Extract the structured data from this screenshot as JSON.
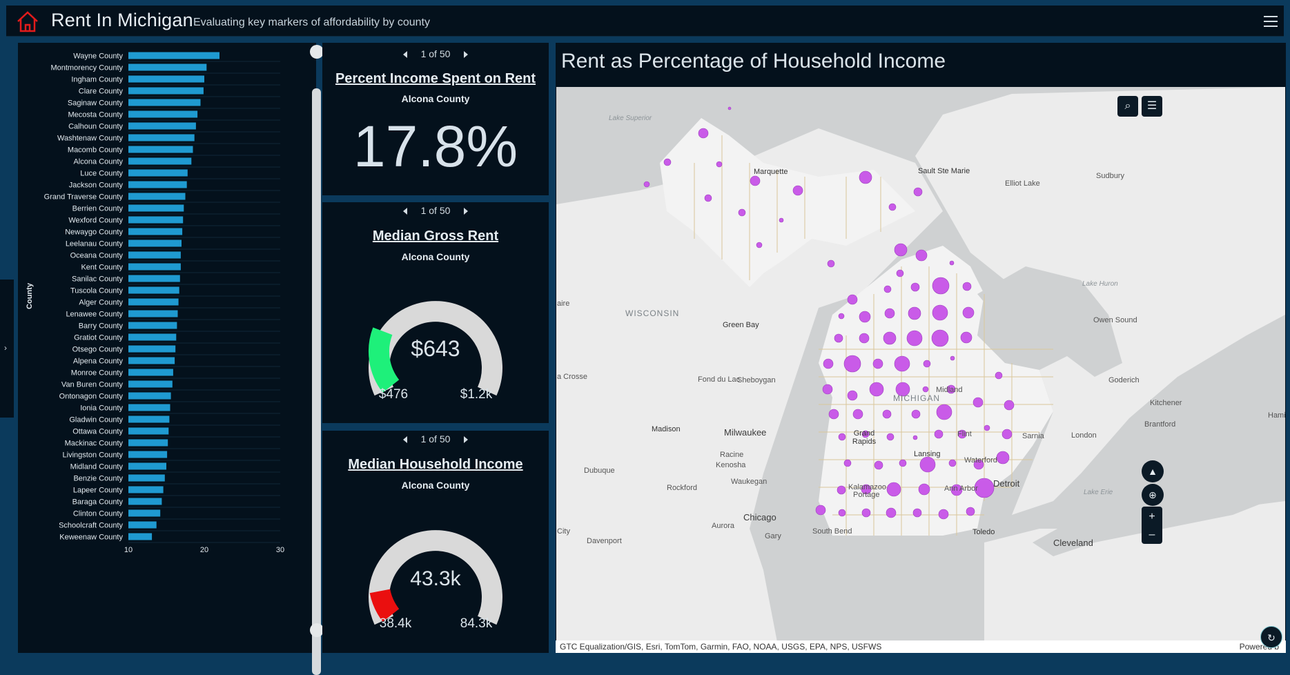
{
  "header": {
    "title": "Rent In Michigan",
    "subtitle": "Evaluating key markers of affordability by county"
  },
  "chart_data": {
    "type": "bar",
    "orientation": "horizontal",
    "ylabel": "County",
    "xlim": [
      10,
      30
    ],
    "xticks": [
      "10",
      "20",
      "30"
    ],
    "categories": [
      "Wayne County",
      "Montmorency County",
      "Ingham County",
      "Clare County",
      "Saginaw County",
      "Mecosta County",
      "Calhoun County",
      "Washtenaw County",
      "Macomb County",
      "Alcona County",
      "Luce County",
      "Jackson County",
      "Grand Traverse County",
      "Berrien County",
      "Wexford County",
      "Newaygo County",
      "Leelanau County",
      "Oceana County",
      "Kent County",
      "Sanilac County",
      "Tuscola County",
      "Alger County",
      "Lenawee County",
      "Barry County",
      "Gratiot County",
      "Otsego County",
      "Alpena County",
      "Monroe County",
      "Van Buren County",
      "Ontonagon County",
      "Ionia County",
      "Gladwin County",
      "Ottawa County",
      "Mackinac County",
      "Livingston County",
      "Midland County",
      "Benzie County",
      "Lapeer County",
      "Baraga County",
      "Clinton County",
      "Schoolcraft County",
      "Keweenaw County"
    ],
    "values": [
      22.0,
      20.3,
      20.0,
      19.9,
      19.5,
      19.1,
      18.9,
      18.7,
      18.5,
      18.3,
      17.8,
      17.7,
      17.5,
      17.3,
      17.2,
      17.1,
      17.0,
      16.9,
      16.9,
      16.8,
      16.7,
      16.6,
      16.5,
      16.4,
      16.3,
      16.2,
      16.1,
      15.9,
      15.8,
      15.6,
      15.5,
      15.4,
      15.3,
      15.2,
      15.1,
      15.0,
      14.8,
      14.6,
      14.4,
      14.2,
      13.7,
      13.1
    ],
    "bar_color": "#1f9ad1"
  },
  "indicators": {
    "pager_text": "1 of 50",
    "pct": {
      "title": "Percent Income Spent on Rent",
      "county": "Alcona County",
      "value": "17.8%"
    },
    "rent": {
      "title": "Median Gross Rent",
      "county": "Alcona County",
      "value": "$643",
      "min": "$476",
      "max": "$1.2k",
      "fraction": 0.23,
      "color": "#1ef07a"
    },
    "income": {
      "title": "Median Household Income",
      "county": "Alcona County",
      "value": "43.3k",
      "min": "38.4k",
      "max": "84.3k",
      "fraction": 0.106,
      "color": "#ea0f0f"
    }
  },
  "map": {
    "title": "Rent as Percentage of Household Income",
    "attribution": "GTC Equalization/GIS, Esri, TomTom, Garmin, FAO, NOAA, USGS, EPA, NPS, USFWS",
    "powered": "Powered b",
    "bubble_color": "#c95be8",
    "labels": {
      "lake_superior": "Lake Superior",
      "marquette": "Marquette",
      "sault": "Sault Ste Marie",
      "elliot": "Elliot Lake",
      "sudbury": "Sudbury",
      "wisconsin": "WISCONSIN",
      "green_bay": "Green Bay",
      "lake_huron": "Lake Huron",
      "owen_sound": "Owen Sound",
      "aire": "aire",
      "la_crosse": "a Crosse",
      "fond_du_lac": "Fond du Lac",
      "sheboygan": "Sheboygan",
      "michigan": "MICHIGAN",
      "midland": "Midland",
      "goderich": "Goderich",
      "kitchener": "Kitchener",
      "hamil": "Hamil",
      "brantford": "Brantford",
      "madison": "Madison",
      "milwaukee": "Milwaukee",
      "grand_rapids": "Grand Rapids",
      "flint": "Flint",
      "sarnia": "Sarnia",
      "london": "London",
      "racine": "Racine",
      "kenosha": "Kenosha",
      "lansing": "Lansing",
      "waterford": "Waterford",
      "dubuque": "Dubuque",
      "waukegan": "Waukegan",
      "rockford": "Rockford",
      "kalamazoo": "Kalamazoo",
      "portage": "Portage",
      "ann_arbor": "Ann Arbor",
      "detroit": "Detroit",
      "chicago": "Chicago",
      "aurora": "Aurora",
      "gary": "Gary",
      "south_bend": "South Bend",
      "toledo": "Toledo",
      "davenport": "Davenport",
      "city": "City",
      "cleveland": "Cleveland",
      "lake_erie": "Lake Erie"
    }
  },
  "icons": {
    "home": "home-icon",
    "menu": "hamburger-menu-icon",
    "search": "search-icon",
    "legend": "legend-list-icon",
    "compass": "compass-icon",
    "locate": "locate-icon",
    "zoom_in": "plus-icon",
    "zoom_out": "minus-icon",
    "refresh": "refresh-icon",
    "expand": "expand-icon",
    "sidetab": "chevron-right-icon"
  },
  "buttons": {
    "zoom_in": "+",
    "zoom_out": "–"
  }
}
